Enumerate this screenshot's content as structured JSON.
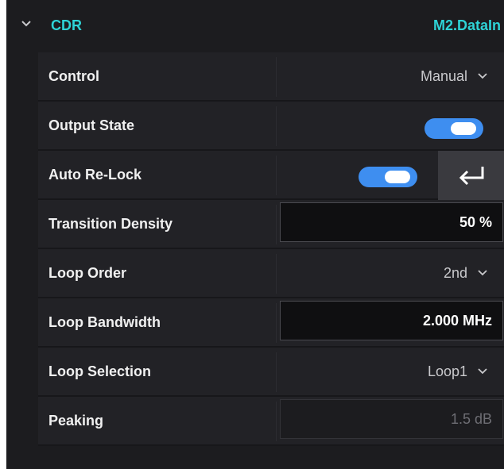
{
  "header": {
    "title": "CDR",
    "source": "M2.DataIn",
    "expand_icon": "chevron-down-icon",
    "accent_color": "#2ed3d6"
  },
  "rows": [
    {
      "label": "Control",
      "type": "dropdown",
      "value": "Manual"
    },
    {
      "label": "Output State",
      "type": "toggle",
      "on": true
    },
    {
      "label": "Auto Re-Lock",
      "type": "toggle-with-button",
      "on": true,
      "button_icon": "enter-return-icon"
    },
    {
      "label": "Transition Density",
      "type": "field",
      "value": "50 %"
    },
    {
      "label": "Loop Order",
      "type": "dropdown",
      "value": "2nd"
    },
    {
      "label": "Loop Bandwidth",
      "type": "field",
      "value": "2.000 MHz"
    },
    {
      "label": "Loop Selection",
      "type": "dropdown",
      "value": "Loop1"
    },
    {
      "label": "Peaking",
      "type": "field-disabled",
      "value": "1.5 dB"
    }
  ],
  "colors": {
    "toggle_on": "#3e8ef0",
    "panel_bg": "#1c1c1f",
    "row_bg": "#222226"
  }
}
